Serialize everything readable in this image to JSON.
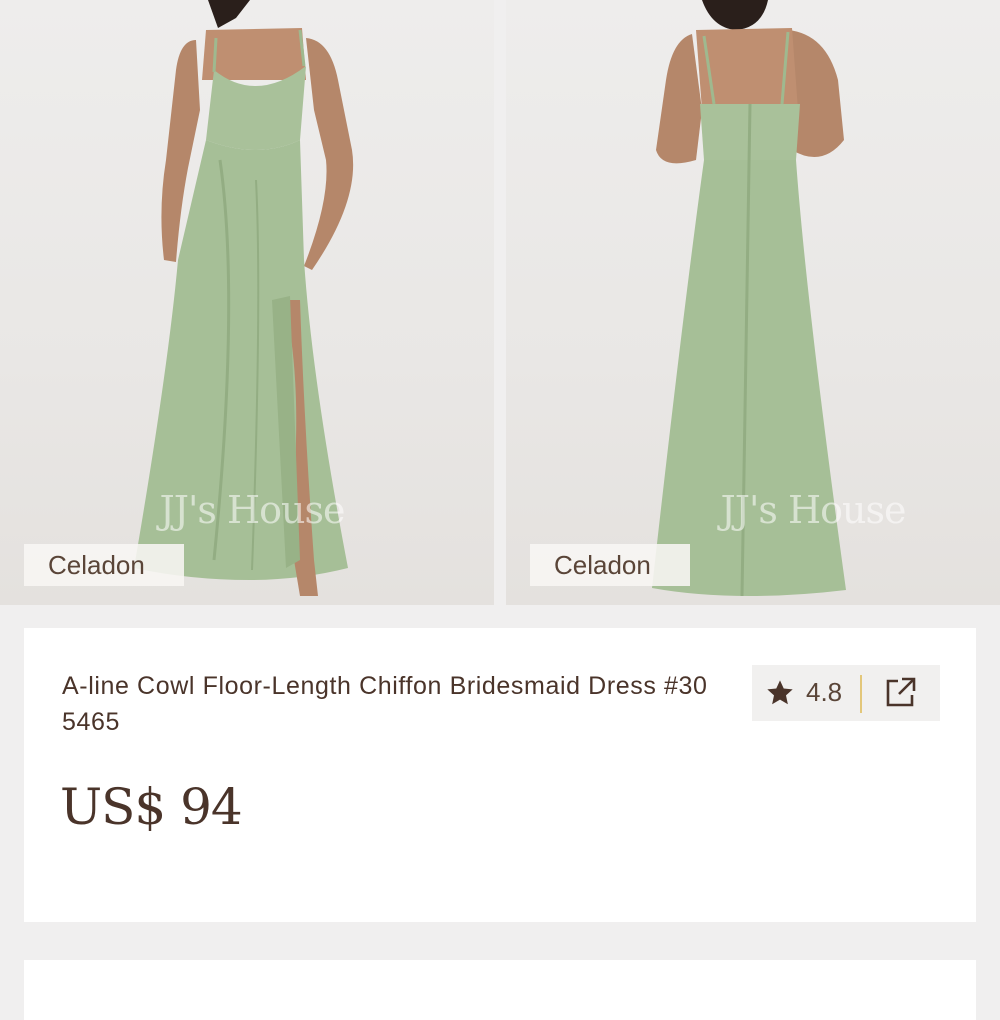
{
  "gallery": {
    "images": [
      {
        "view": "front",
        "color_label": "Celadon",
        "watermark": "JJ's House"
      },
      {
        "view": "back",
        "color_label": "Celadon",
        "watermark": "JJ's House"
      }
    ]
  },
  "product": {
    "title": "A-line Cowl Floor-Length Chiffon Bridesmaid Dress #305465",
    "price": "US$ 94",
    "rating": "4.8",
    "dress_color": "#a9c19a",
    "accent_divider_color": "#e3c77a",
    "icons": {
      "rating": "star-icon",
      "share": "share-external-icon"
    }
  }
}
